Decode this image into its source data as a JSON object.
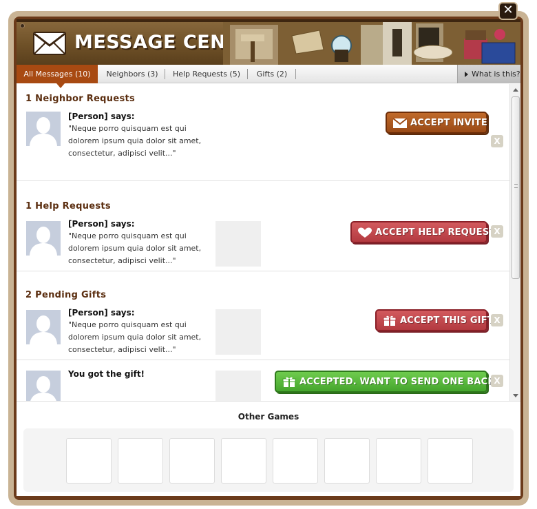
{
  "window": {
    "close_label": "✕"
  },
  "header": {
    "title": "MESSAGE CENTER",
    "icon": "envelope-icon"
  },
  "tabs": [
    {
      "label": "All Messages (10)",
      "active": true
    },
    {
      "label": "Neighbors (3)",
      "active": false
    },
    {
      "label": "Help Requests (5)",
      "active": false
    },
    {
      "label": "Gifts (2)",
      "active": false
    }
  ],
  "help_link": {
    "label": "What is this?",
    "icon": "caret-right-icon"
  },
  "sections": [
    {
      "title": "1 Neighbor Requests",
      "items": [
        {
          "sender": "[Person] says:",
          "message": "\"Neque porro quisquam est qui dolorem ipsum quia dolor sit amet, consectetur, adipisci velit...\"",
          "has_thumbnail": false,
          "action": {
            "label": "ACCEPT INVITE",
            "icon": "envelope-icon",
            "color": "#a8501c"
          },
          "dismiss_label": "X"
        }
      ]
    },
    {
      "title": "1 Help Requests",
      "items": [
        {
          "sender": "[Person] says:",
          "message": "\"Neque porro quisquam est qui dolorem ipsum quia dolor sit amet, consectetur, adipisci velit...\"",
          "has_thumbnail": true,
          "action": {
            "label": "ACCEPT HELP REQUEST",
            "icon": "heart-icon",
            "color": "#c2484d"
          },
          "dismiss_label": "X"
        }
      ]
    },
    {
      "title": "2 Pending Gifts",
      "items": [
        {
          "sender": "[Person] says:",
          "message": "\"Neque porro quisquam est qui dolorem ipsum quia dolor sit amet, consectetur, adipisci velit...\"",
          "has_thumbnail": true,
          "action": {
            "label": "ACCEPT THIS GIFT",
            "icon": "gift-icon",
            "color": "#c2484d"
          },
          "dismiss_label": "X"
        },
        {
          "sender": "You got the gift!",
          "message": "",
          "has_thumbnail": true,
          "action": {
            "label": "ACCEPTED. WANT TO SEND ONE BACK?",
            "icon": "gift-icon",
            "color": "#55b43a"
          },
          "dismiss_label": "X"
        }
      ]
    }
  ],
  "other_games": {
    "title": "Other Games",
    "slot_count": 8
  },
  "colors": {
    "frame": "#6b3a1a",
    "tab_active": "#a84a12",
    "section_title": "#5b2e10"
  }
}
